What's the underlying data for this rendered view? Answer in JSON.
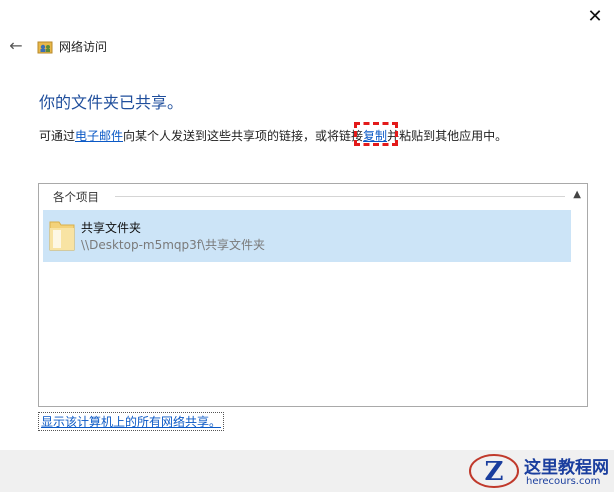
{
  "window": {
    "title": "网络访问",
    "close_glyph": "✕",
    "back_glyph": "←"
  },
  "main": {
    "heading": "你的文件夹已共享。",
    "description": {
      "part1": "可通过",
      "email_link": "电子邮件",
      "part2": "向某个人发送到这些共享项的链接，或将链接",
      "copy_link": "复制",
      "part3": "并粘贴到其他应用中。"
    }
  },
  "panel": {
    "header": "各个项目",
    "items": [
      {
        "name": "共享文件夹",
        "path": "\\\\Desktop-m5mqp3f\\共享文件夹"
      }
    ]
  },
  "footer": {
    "link": "显示该计算机上的所有网络共享。"
  },
  "watermark": {
    "title": "这里教程网",
    "url": "herecours.com"
  },
  "colors": {
    "heading": "#1f4e9c",
    "link": "#0b59c6",
    "selection": "#cce4f7",
    "highlight": "#e31a1a"
  }
}
